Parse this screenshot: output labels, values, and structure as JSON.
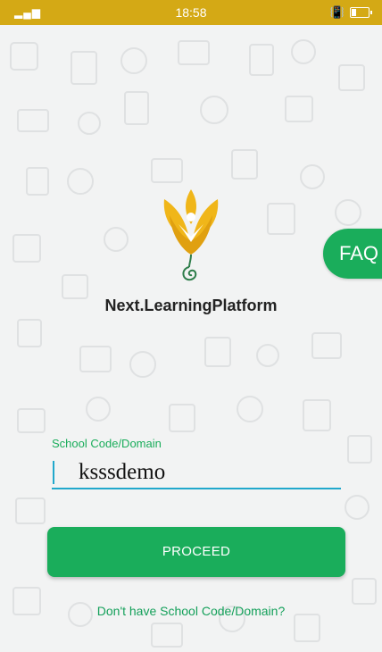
{
  "status_bar": {
    "signal": "▂▄▆ ",
    "time": "18:58",
    "vibrate": "📳"
  },
  "brand": {
    "name": "Next.LearningPlatform"
  },
  "faq": {
    "label": "FAQ"
  },
  "form": {
    "label": "School Code/Domain",
    "value": "ksssdemo",
    "proceed_label": "PROCEED",
    "help_link": "Don't have School Code/Domain?"
  },
  "colors": {
    "accent": "#1aad5b",
    "status": "#d4a915",
    "input_line": "#21a8cc"
  }
}
